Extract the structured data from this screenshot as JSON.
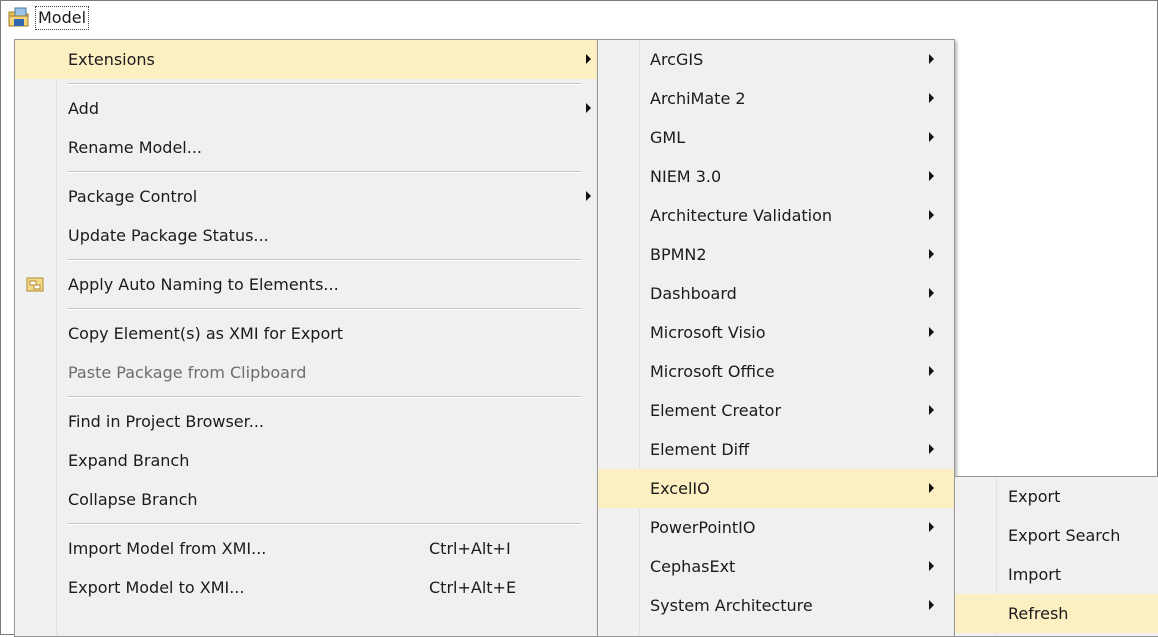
{
  "tree": {
    "root_label": "Model",
    "root_icon": "package-folder-icon"
  },
  "context_menu": {
    "groups": [
      [
        {
          "label": "Extensions",
          "submenu": true,
          "highlighted": true
        }
      ],
      [
        {
          "label": "Add",
          "submenu": true
        },
        {
          "label": "Rename Model..."
        }
      ],
      [
        {
          "label": "Package Control",
          "submenu": true
        },
        {
          "label": "Update Package Status..."
        }
      ],
      [
        {
          "label": "Apply Auto Naming to Elements...",
          "icon": "auto-naming-icon"
        }
      ],
      [
        {
          "label": "Copy Element(s) as XMI for Export"
        },
        {
          "label": "Paste Package from Clipboard",
          "disabled": true
        }
      ],
      [
        {
          "label": "Find in Project Browser..."
        },
        {
          "label": "Expand Branch"
        },
        {
          "label": "Collapse Branch"
        }
      ],
      [
        {
          "label": "Import Model from XMI...",
          "shortcut": "Ctrl+Alt+I"
        },
        {
          "label": "Export Model to XMI...",
          "shortcut": "Ctrl+Alt+E"
        }
      ]
    ]
  },
  "extensions_menu": {
    "items": [
      {
        "label": "ArcGIS",
        "submenu": true
      },
      {
        "label": "ArchiMate 2",
        "submenu": true
      },
      {
        "label": "GML",
        "submenu": true
      },
      {
        "label": "NIEM 3.0",
        "submenu": true
      },
      {
        "label": "Architecture Validation",
        "submenu": true
      },
      {
        "label": "BPMN2",
        "submenu": true
      },
      {
        "label": "Dashboard",
        "submenu": true
      },
      {
        "label": "Microsoft Visio",
        "submenu": true
      },
      {
        "label": "Microsoft Office",
        "submenu": true
      },
      {
        "label": "Element Creator",
        "submenu": true
      },
      {
        "label": "Element Diff",
        "submenu": true
      },
      {
        "label": "ExcelIO",
        "submenu": true,
        "highlighted": true
      },
      {
        "label": "PowerPointIO",
        "submenu": true
      },
      {
        "label": "CephasExt",
        "submenu": true
      },
      {
        "label": "System Architecture",
        "submenu": true
      }
    ]
  },
  "excelio_menu": {
    "items": [
      {
        "label": "Export"
      },
      {
        "label": "Export Search"
      },
      {
        "label": "Import"
      },
      {
        "label": "Refresh",
        "highlighted": true
      }
    ]
  },
  "colors": {
    "highlight": "#fcf0c3",
    "menu_background": "#f0f0f0",
    "menu_border": "#979797",
    "disabled_text": "#6d6d6d"
  }
}
